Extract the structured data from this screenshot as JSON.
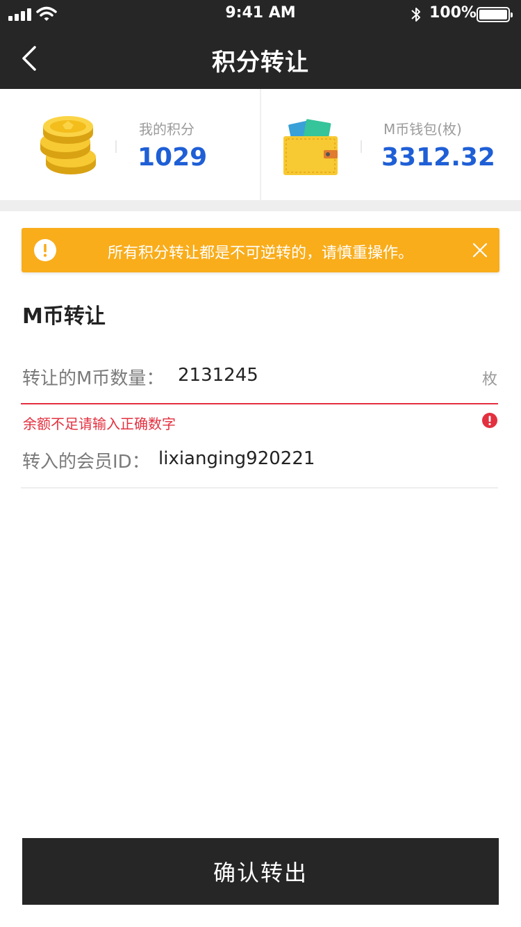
{
  "status_bar": {
    "time": "9:41 AM",
    "battery": "100%"
  },
  "header": {
    "title": "积分转让"
  },
  "summary": {
    "points_label": "我的积分",
    "points_value": "1029",
    "wallet_label": "M币钱包(枚)",
    "wallet_value": "3312.32"
  },
  "alert": {
    "message": "所有积分转让都是不可逆转的，请慎重操作。"
  },
  "section": {
    "title": "M币转让"
  },
  "form": {
    "amount_label": "转让的M币数量：",
    "amount_value": "2131245",
    "amount_unit": "枚",
    "amount_error": "余额不足请输入正确数字",
    "member_label": "转入的会员ID：",
    "member_value": "lixianging920221"
  },
  "confirm_button": "确认转出",
  "colors": {
    "accent": "#1f5fd6",
    "warning": "#f9ad1b",
    "error": "#e3303f",
    "dark": "#262626"
  }
}
